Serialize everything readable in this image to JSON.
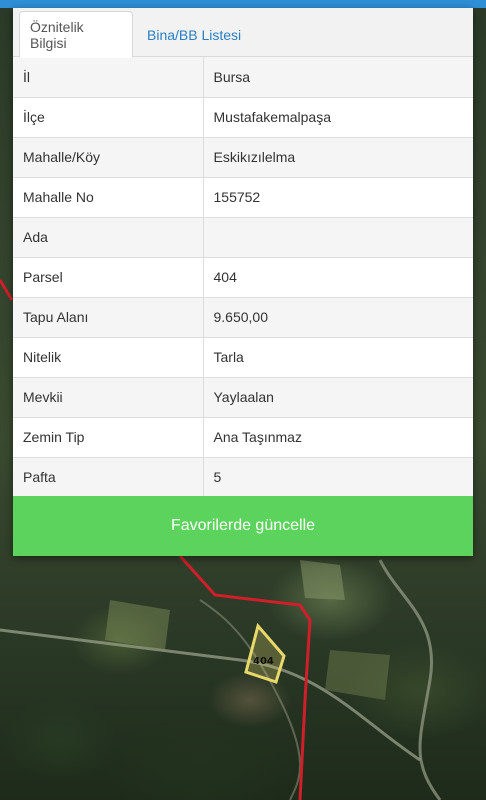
{
  "tabs": [
    {
      "label": "Öznitelik Bilgisi",
      "active": true
    },
    {
      "label": "Bina/BB Listesi",
      "active": false
    }
  ],
  "attributes": [
    {
      "key": "İl",
      "value": "Bursa"
    },
    {
      "key": "İlçe",
      "value": "Mustafakemalpaşa"
    },
    {
      "key": "Mahalle/Köy",
      "value": "Eskikızılelma"
    },
    {
      "key": "Mahalle No",
      "value": "155752"
    },
    {
      "key": "Ada",
      "value": ""
    },
    {
      "key": "Parsel",
      "value": "404"
    },
    {
      "key": "Tapu Alanı",
      "value": "9.650,00"
    },
    {
      "key": "Nitelik",
      "value": "Tarla"
    },
    {
      "key": "Mevkii",
      "value": "Yaylaalan"
    },
    {
      "key": "Zemin Tip",
      "value": "Ana Taşınmaz"
    },
    {
      "key": "Pafta",
      "value": "5"
    }
  ],
  "action_button": {
    "label": "Favorilerde güncelle"
  },
  "map": {
    "parcel_label": "404"
  },
  "colors": {
    "header_blue": "#2f8fd6",
    "button_green": "#5cd35c",
    "tab_link": "#2a7ec4",
    "boundary_red": "#d01f2a",
    "parcel_outline": "#e8d86a"
  }
}
